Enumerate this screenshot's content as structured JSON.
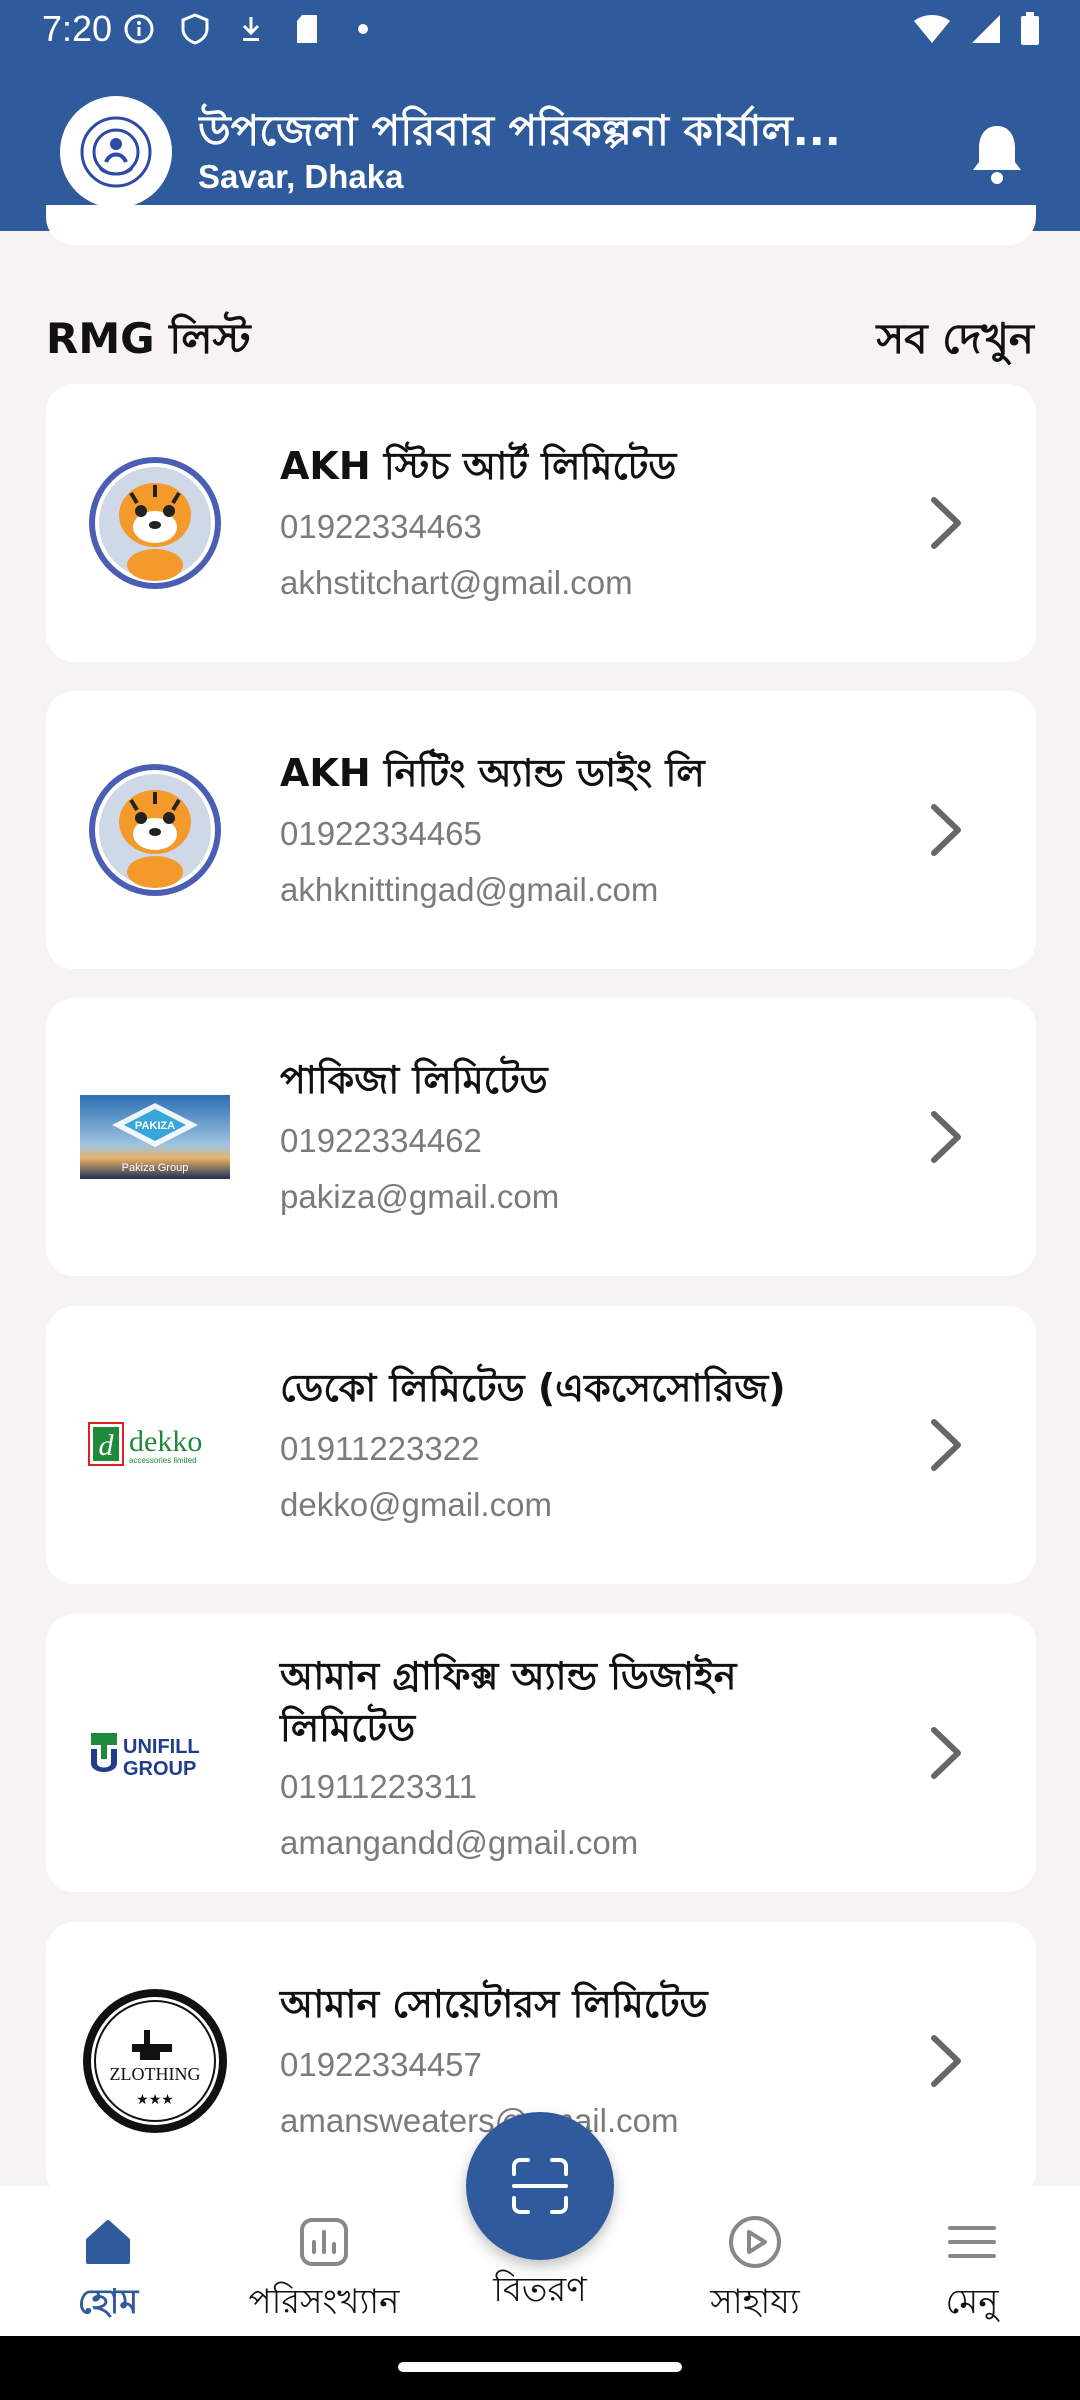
{
  "status": {
    "time": "7:20"
  },
  "header": {
    "title": "উপজেলা পরিবার পরিকল্পনা কার্যাল...",
    "subtitle": "Savar, Dhaka"
  },
  "section": {
    "title": "RMG লিস্ট",
    "see_all": "সব দেখুন"
  },
  "companies": [
    {
      "name": "AKH স্টিচ আর্ট লিমিটেড",
      "phone": "01922334463",
      "email": "akhstitchart@gmail.com",
      "logo": "tiger-logo"
    },
    {
      "name": "AKH নিটিং অ্যান্ড ডাইং লি",
      "phone": "01922334465",
      "email": "akhknittingad@gmail.com",
      "logo": "tiger-logo"
    },
    {
      "name": "পাকিজা লিমিটেড",
      "phone": "01922334462",
      "email": "pakiza@gmail.com",
      "logo": "pakiza-logo",
      "logo_text": "PAKIZA",
      "logo_sub": "Pakiza Group"
    },
    {
      "name": "ডেকো লিমিটেড (একসেসোরিজ)",
      "phone": "01911223322",
      "email": "dekko@gmail.com",
      "logo": "dekko-logo",
      "logo_text": "dekko",
      "logo_sub": "accessories limited"
    },
    {
      "name": "আমান গ্রাফিক্স অ্যান্ড ডিজাইন লিমিটেড",
      "phone": "01911223311",
      "email": "amangandd@gmail.com",
      "logo": "unifill-logo",
      "logo_text": "UNIFILL",
      "logo_sub": "GROUP"
    },
    {
      "name": "আমান সোয়েটারস লিমিটেড",
      "phone": "01922334457",
      "email": "amansweaters@gmail.com",
      "logo": "zlothing-logo",
      "logo_text": "ZLOTHING"
    }
  ],
  "nav": {
    "home": "হোম",
    "stats": "পরিসংখ্যান",
    "distribution": "বিতরণ",
    "help": "সাহায্য",
    "menu": "মেনু"
  },
  "colors": {
    "primary": "#2f5a9c",
    "background": "#f7f3f2"
  }
}
